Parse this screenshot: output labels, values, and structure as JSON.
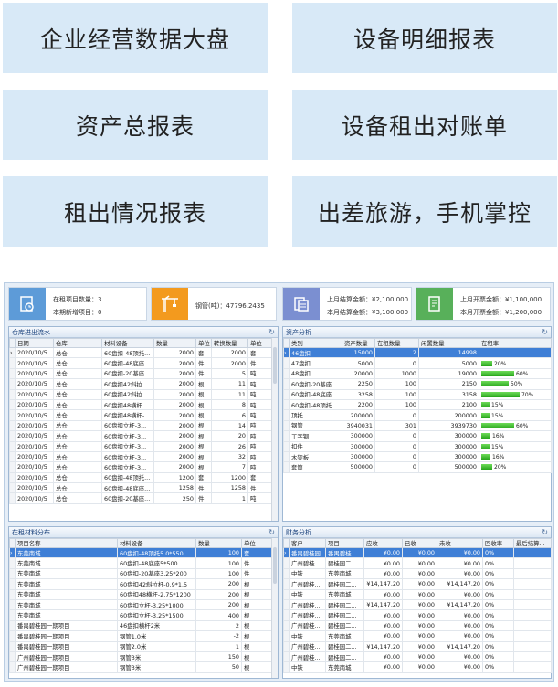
{
  "tiles": [
    "企业经营数据大盘",
    "设备明细报表",
    "资产总报表",
    "设备租出对账单",
    "租出情况报表",
    "出差旅游，手机掌控"
  ],
  "kpis": [
    {
      "l1": "在租项目数量：3",
      "l2": "本期新增项目：0",
      "icon": "project-icon",
      "color": "#5d9bd8"
    },
    {
      "l1": "钢管(吨)：47796.2435",
      "l2": "",
      "icon": "crane-icon",
      "color": "#f39a1e"
    },
    {
      "l1": "上月结算金额：¥2,100,000",
      "l2": "本月结算金额：¥3,100,000",
      "icon": "document-icon",
      "color": "#7b8fd1"
    },
    {
      "l1": "上月开票金额：¥1,100,000",
      "l2": "本月开票金额：¥1,200,000",
      "icon": "invoice-icon",
      "color": "#58b05a"
    }
  ],
  "warehouse": {
    "title": "仓库进出流水",
    "headers": [
      "日期",
      "仓库",
      "材料设备",
      "数量",
      "单位",
      "转换数量",
      "单位"
    ],
    "rows": [
      [
        "2020/10/5",
        "总仓",
        "60盘扣-48顶托...",
        "2000",
        "套",
        "2000",
        "套"
      ],
      [
        "2020/10/5",
        "总仓",
        "60盘扣-48底座...",
        "2000",
        "件",
        "2000",
        "件"
      ],
      [
        "2020/10/5",
        "总仓",
        "60盘扣-20基座...",
        "2000",
        "件",
        "5",
        "吨"
      ],
      [
        "2020/10/5",
        "总仓",
        "60盘扣42斜拉...",
        "2000",
        "根",
        "11",
        "吨"
      ],
      [
        "2020/10/5",
        "总仓",
        "60盘扣42斜拉...",
        "2000",
        "根",
        "11",
        "吨"
      ],
      [
        "2020/10/5",
        "总仓",
        "60盘扣48横杆...",
        "2000",
        "根",
        "8",
        "吨"
      ],
      [
        "2020/10/5",
        "总仓",
        "60盘扣48横杆-...",
        "2000",
        "根",
        "6",
        "吨"
      ],
      [
        "2020/10/5",
        "总仓",
        "60盘扣立杆-3...",
        "2000",
        "根",
        "14",
        "吨"
      ],
      [
        "2020/10/5",
        "总仓",
        "60盘扣立杆-3...",
        "2000",
        "根",
        "20",
        "吨"
      ],
      [
        "2020/10/5",
        "总仓",
        "60盘扣立杆-3...",
        "2000",
        "根",
        "26",
        "吨"
      ],
      [
        "2020/10/5",
        "总仓",
        "60盘扣立杆-3...",
        "2000",
        "根",
        "32",
        "吨"
      ],
      [
        "2020/10/5",
        "总仓",
        "60盘扣立杆-3...",
        "2000",
        "根",
        "7",
        "吨"
      ],
      [
        "2020/10/5",
        "总仓",
        "60盘扣-48顶托...",
        "1200",
        "套",
        "1200",
        "套"
      ],
      [
        "2020/10/5",
        "总仓",
        "60盘扣-48底座...",
        "1258",
        "件",
        "1258",
        "件"
      ],
      [
        "2020/10/5",
        "总仓",
        "60盘扣-20基座...",
        "250",
        "件",
        "1",
        "吨"
      ]
    ]
  },
  "assets": {
    "title": "资产分析",
    "headers": [
      "类别",
      "资产数量",
      "在租数量",
      "闲置数量",
      "在租率"
    ],
    "rows": [
      {
        "c": [
          "46盘扣",
          "15000",
          "2",
          "14998"
        ],
        "rate": 0,
        "label": ""
      },
      {
        "c": [
          "47盘扣",
          "5000",
          "0",
          "5000"
        ],
        "rate": 0.2,
        "label": "20%"
      },
      {
        "c": [
          "48盘扣",
          "20000",
          "1000",
          "19000"
        ],
        "rate": 0.6,
        "label": "60%"
      },
      {
        "c": [
          "60盘扣-20基座",
          "2250",
          "100",
          "2150"
        ],
        "rate": 0.5,
        "label": "50%"
      },
      {
        "c": [
          "60盘扣-48底座",
          "3258",
          "100",
          "3158"
        ],
        "rate": 0.7,
        "label": "70%"
      },
      {
        "c": [
          "60盘扣-48顶托",
          "2200",
          "100",
          "2100"
        ],
        "rate": 0.15,
        "label": "15%"
      },
      {
        "c": [
          "顶托",
          "200000",
          "0",
          "200000"
        ],
        "rate": 0.15,
        "label": "15%"
      },
      {
        "c": [
          "钢管",
          "3940031",
          "301",
          "3939730"
        ],
        "rate": 0.6,
        "label": "60%"
      },
      {
        "c": [
          "工字钢",
          "300000",
          "0",
          "300000"
        ],
        "rate": 0.16,
        "label": "16%"
      },
      {
        "c": [
          "扣件",
          "300000",
          "0",
          "300000"
        ],
        "rate": 0.15,
        "label": "15%"
      },
      {
        "c": [
          "木架板",
          "300000",
          "0",
          "300000"
        ],
        "rate": 0.16,
        "label": "16%"
      },
      {
        "c": [
          "套筒",
          "500000",
          "0",
          "500000"
        ],
        "rate": 0.2,
        "label": "20%"
      }
    ]
  },
  "rental": {
    "title": "在租材料分布",
    "headers": [
      "项目名称",
      "材料设备",
      "数量",
      "单位"
    ],
    "rows": [
      [
        "东莞南城",
        "60盘扣-48顶托5.0*550",
        "100",
        "套"
      ],
      [
        "东莞南城",
        "60盘扣-48底座5*500",
        "100",
        "件"
      ],
      [
        "东莞南城",
        "60盘扣-20基座3.25*200",
        "100",
        "件"
      ],
      [
        "东莞南城",
        "60盘扣42斜拉杆-0.9*1.5",
        "200",
        "根"
      ],
      [
        "东莞南城",
        "60盘扣48横杆-2.75*1200",
        "200",
        "根"
      ],
      [
        "东莞南城",
        "60盘扣立杆-3.25*1000",
        "200",
        "根"
      ],
      [
        "东莞南城",
        "60盘扣立杆-3.25*1500",
        "400",
        "根"
      ],
      [
        "番禺碧桂园一期项目",
        "46盘扣横杆2米",
        "2",
        "根"
      ],
      [
        "番禺碧桂园一期项目",
        "钢管1.0米",
        "-2",
        "根"
      ],
      [
        "番禺碧桂园一期项目",
        "钢管2.0米",
        "1",
        "根"
      ],
      [
        "广州碧桂园一期项目",
        "钢管3米",
        "150",
        "根"
      ],
      [
        "广州碧桂园一期项目",
        "钢管3米",
        "50",
        "根"
      ]
    ]
  },
  "finance": {
    "title": "财务分析",
    "headers": [
      "客户",
      "项目",
      "应收",
      "已收",
      "未收",
      "回收率",
      "最后结算..."
    ],
    "rows": [
      [
        "番禺碧桂园",
        "番禺碧桂...",
        "¥0.00",
        "¥0.00",
        "¥0.00",
        "0%",
        ""
      ],
      [
        "广州碧桂...",
        "碧桂园二...",
        "¥0.00",
        "¥0.00",
        "¥0.00",
        "0%",
        ""
      ],
      [
        "中铁",
        "东莞南城",
        "¥0.00",
        "¥0.00",
        "¥0.00",
        "0%",
        ""
      ],
      [
        "广州碧桂...",
        "碧桂园二...",
        "¥14,147.20",
        "¥0.00",
        "¥14,147.20",
        "0%",
        ""
      ],
      [
        "中铁",
        "东莞南城",
        "¥0.00",
        "¥0.00",
        "¥0.00",
        "0%",
        ""
      ],
      [
        "广州碧桂...",
        "碧桂园二...",
        "¥14,147.20",
        "¥0.00",
        "¥14,147.20",
        "0%",
        ""
      ],
      [
        "广州碧桂...",
        "碧桂园二...",
        "¥0.00",
        "¥0.00",
        "¥0.00",
        "0%",
        ""
      ],
      [
        "广州碧桂...",
        "碧桂园二...",
        "¥0.00",
        "¥0.00",
        "¥0.00",
        "0%",
        ""
      ],
      [
        "中铁",
        "东莞南城",
        "¥0.00",
        "¥0.00",
        "¥0.00",
        "0%",
        ""
      ],
      [
        "广州碧桂...",
        "碧桂园二...",
        "¥14,147.20",
        "¥0.00",
        "¥14,147.20",
        "0%",
        ""
      ],
      [
        "广州碧桂...",
        "碧桂园二...",
        "¥0.00",
        "¥0.00",
        "¥0.00",
        "0%",
        ""
      ],
      [
        "中铁",
        "东莞南城",
        "¥0.00",
        "¥0.00",
        "¥0.00",
        "0%",
        ""
      ]
    ]
  }
}
